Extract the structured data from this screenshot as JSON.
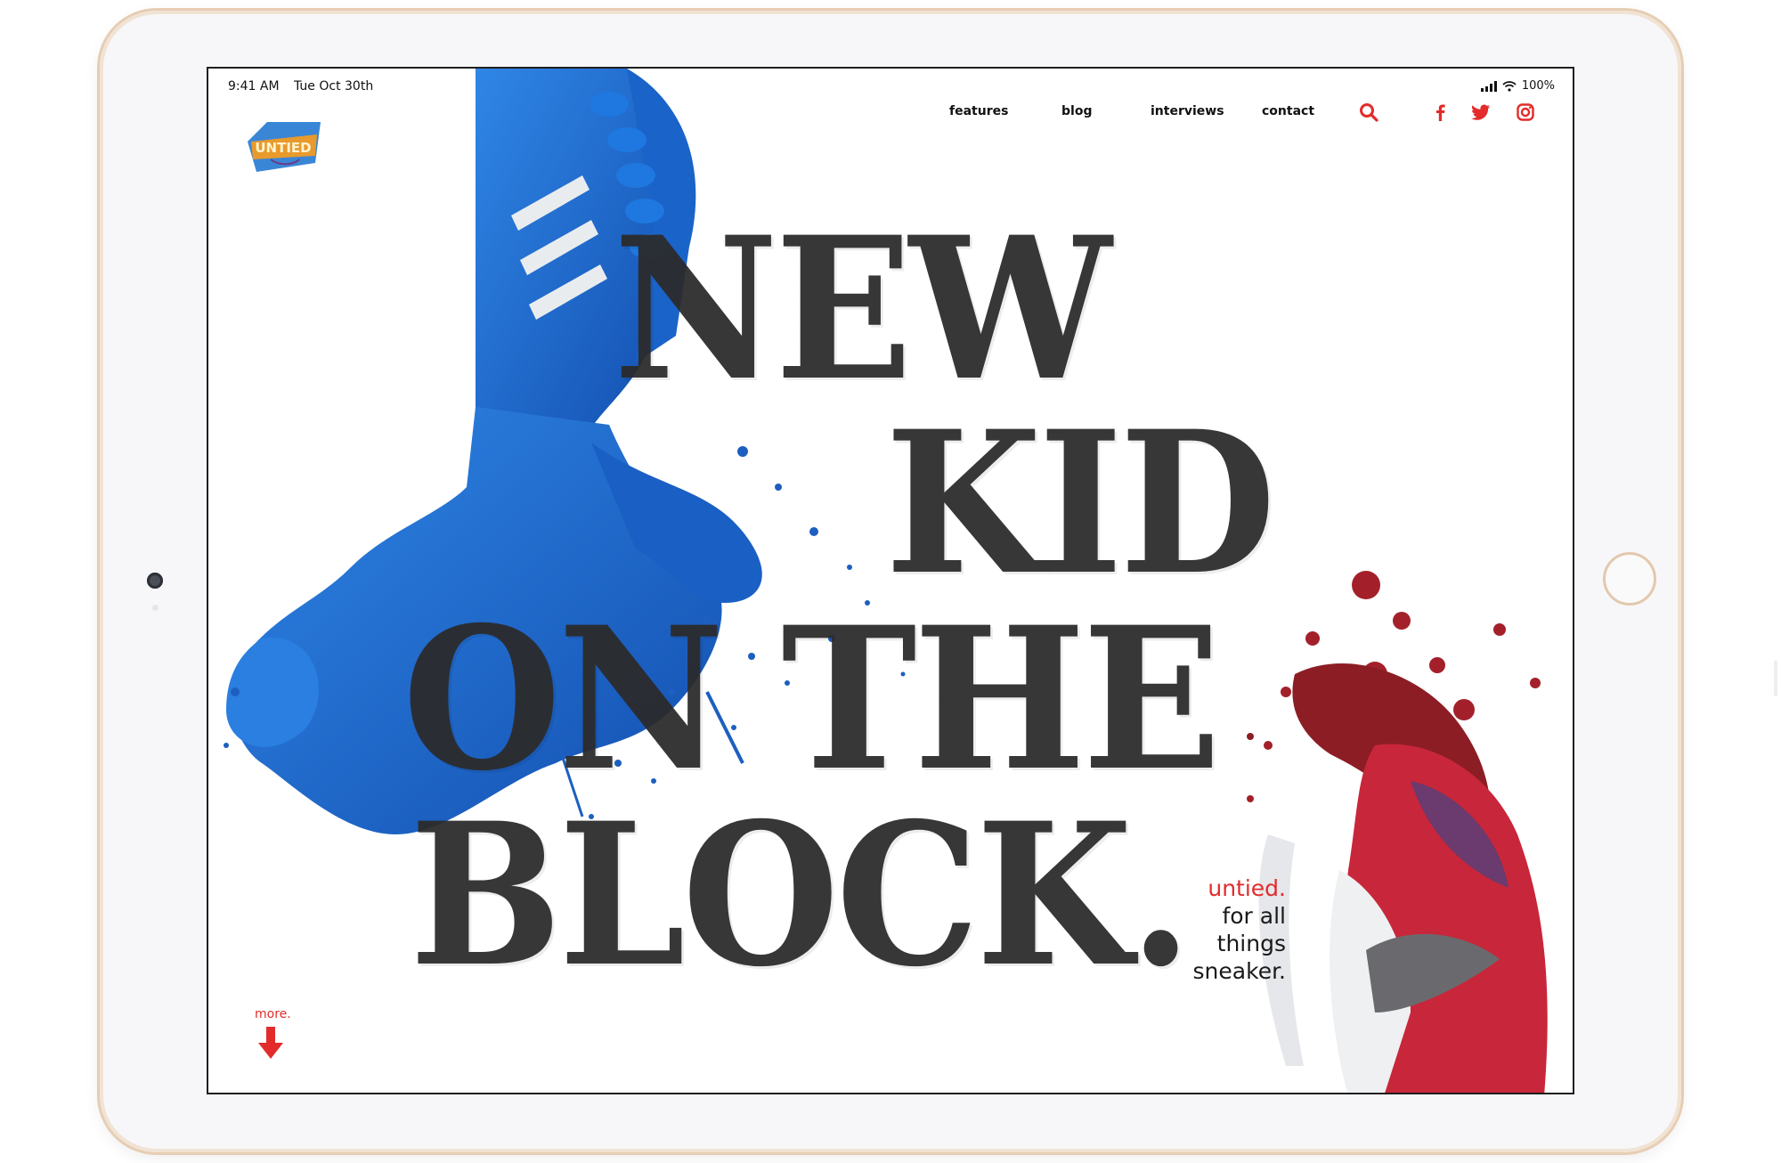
{
  "status_bar": {
    "time": "9:41 AM",
    "date": "Tue Oct 30th",
    "battery": "100%"
  },
  "logo": {
    "text": "UNTIED"
  },
  "nav": {
    "items": [
      {
        "label": "features"
      },
      {
        "label": "blog"
      },
      {
        "label": "interviews"
      },
      {
        "label": "contact"
      }
    ],
    "icons": [
      "search-icon",
      "facebook-icon",
      "twitter-icon",
      "instagram-icon"
    ]
  },
  "hero": {
    "lines": [
      "NEW",
      "KID",
      "ON THE",
      "BLOCK."
    ]
  },
  "tagline": {
    "brand": "untied.",
    "line1": "for all",
    "line2": "things",
    "line3": "sneaker."
  },
  "more": {
    "label": "more."
  },
  "colors": {
    "accent": "#e32b2b",
    "headline": "#2b2b2b",
    "shoe_blue": "#1f6fd1",
    "shoe_red": "#c8263a"
  }
}
